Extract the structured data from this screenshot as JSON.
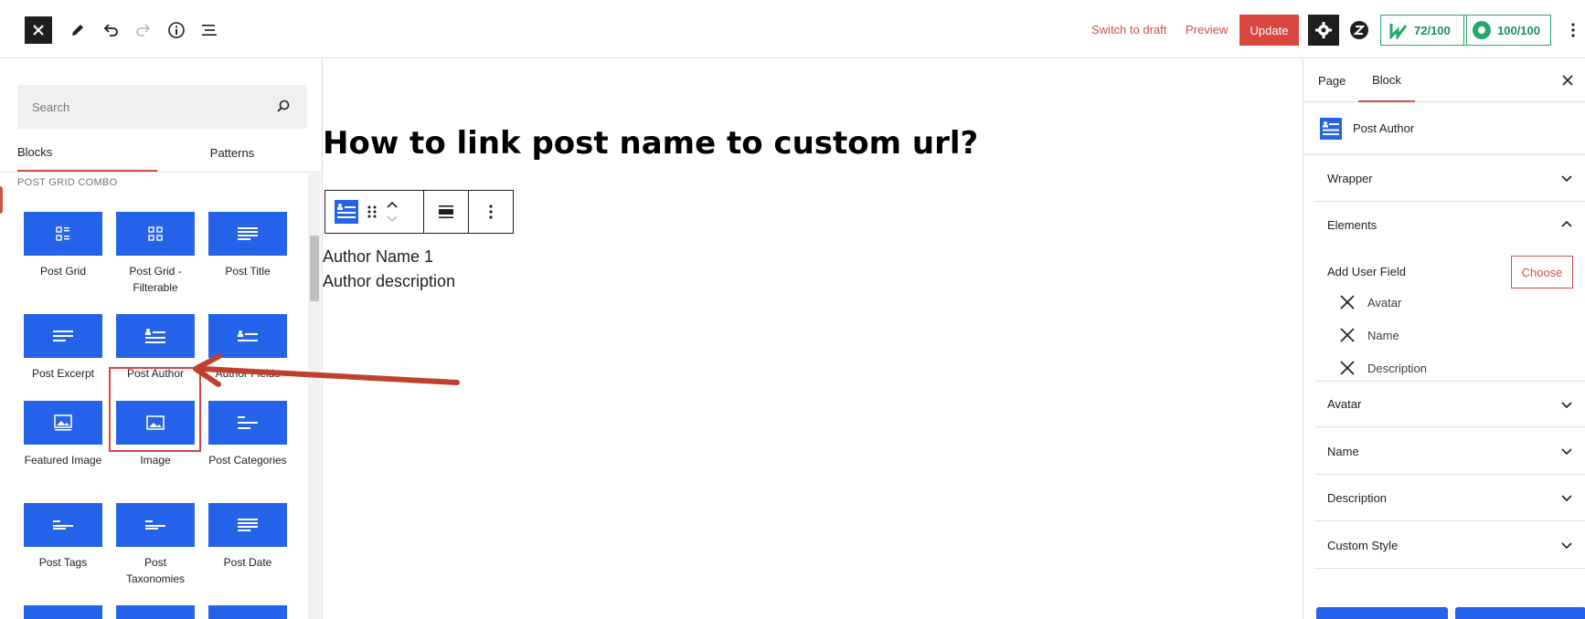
{
  "topbar": {
    "close_icon": "close-icon",
    "switch_to_draft": "Switch to draft",
    "preview": "Preview",
    "update": "Update",
    "score_seo": "72/100",
    "score_readability": "100/100"
  },
  "inserter": {
    "search_placeholder": "Search",
    "tabs": [
      "Blocks",
      "Patterns"
    ],
    "category": "POST GRID COMBO",
    "blocks": [
      {
        "label": "Post Grid",
        "icon": "grid-icon"
      },
      {
        "label": "Post Grid - Filterable",
        "icon": "grid-icon"
      },
      {
        "label": "Post Title",
        "icon": "lines-icon"
      },
      {
        "label": "Post Excerpt",
        "icon": "lines-icon"
      },
      {
        "label": "Post Author",
        "icon": "author-icon"
      },
      {
        "label": "Author Fields",
        "icon": "author-icon"
      },
      {
        "label": "Featured Image",
        "icon": "image-icon"
      },
      {
        "label": "Image",
        "icon": "image-icon"
      },
      {
        "label": "Post Categories",
        "icon": "short-lines-icon"
      },
      {
        "label": "Post Tags",
        "icon": "short-lines-icon"
      },
      {
        "label": "Post Taxonomies",
        "icon": "short-lines-icon"
      },
      {
        "label": "Post Date",
        "icon": "lines-icon"
      }
    ]
  },
  "canvas": {
    "title": "How to link post name to custom url?",
    "author_name": "Author Name 1",
    "author_description": "Author description"
  },
  "sidebar": {
    "tabs": [
      "Page",
      "Block"
    ],
    "block_name": "Post Author",
    "sections": {
      "wrapper": "Wrapper",
      "elements": "Elements",
      "avatar": "Avatar",
      "name": "Name",
      "description": "Description",
      "custom_style": "Custom Style"
    },
    "add_user_field": "Add User Field",
    "choose": "Choose",
    "elements": [
      "Avatar",
      "Name",
      "Description"
    ]
  },
  "colors": {
    "accent_red": "#d9463e",
    "block_blue": "#2563eb",
    "score_green": "#25a86b"
  }
}
